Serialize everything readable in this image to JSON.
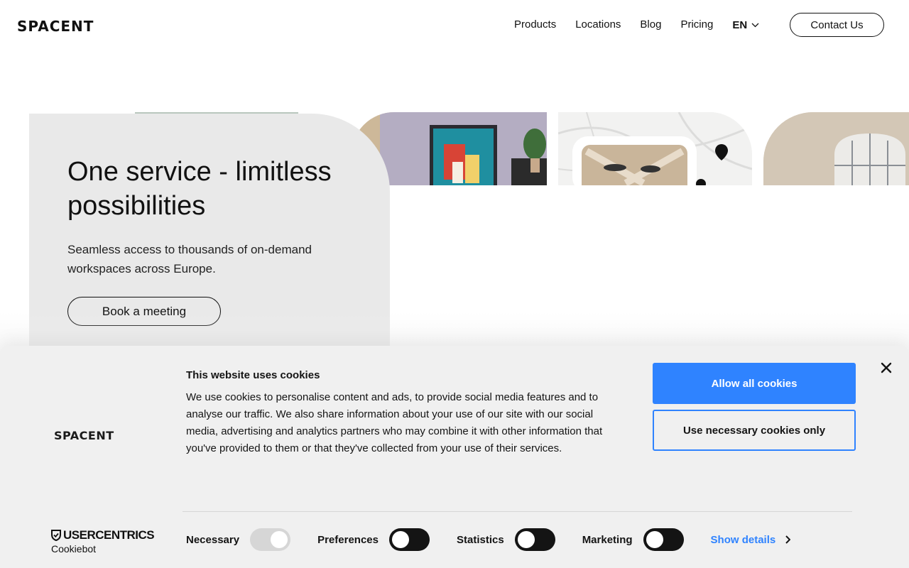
{
  "header": {
    "logo": "SPACENT",
    "nav": [
      "Products",
      "Locations",
      "Blog",
      "Pricing"
    ],
    "language": "EN",
    "contact_label": "Contact Us"
  },
  "hero": {
    "title": "One service - limitless possibilities",
    "subtitle": "Seamless access to thousands of on-demand workspaces across Europe.",
    "cta_label": "Book a meeting"
  },
  "cookie_banner": {
    "logo": "SPACENT",
    "title": "This website uses cookies",
    "body": "We use cookies to personalise content and ads, to provide social media features and to analyse our traffic. We also share information about your use of our site with our social media, advertising and analytics partners who may combine it with other information that you've provided to them or that they've collected from your use of their services.",
    "allow_all_label": "Allow all cookies",
    "necessary_only_label": "Use necessary cookies only",
    "toggles": [
      {
        "label": "Necessary",
        "state": "on-disabled"
      },
      {
        "label": "Preferences",
        "state": "off"
      },
      {
        "label": "Statistics",
        "state": "off"
      },
      {
        "label": "Marketing",
        "state": "off"
      }
    ],
    "show_details_label": "Show details",
    "provider_logo_top": "USERCENTRICS",
    "provider_logo_bottom": "Cookiebot"
  },
  "colors": {
    "accent": "#2f83ff",
    "text": "#141414",
    "hero_card": "#e9e9e9",
    "banner_bg": "#f0f0f0"
  }
}
